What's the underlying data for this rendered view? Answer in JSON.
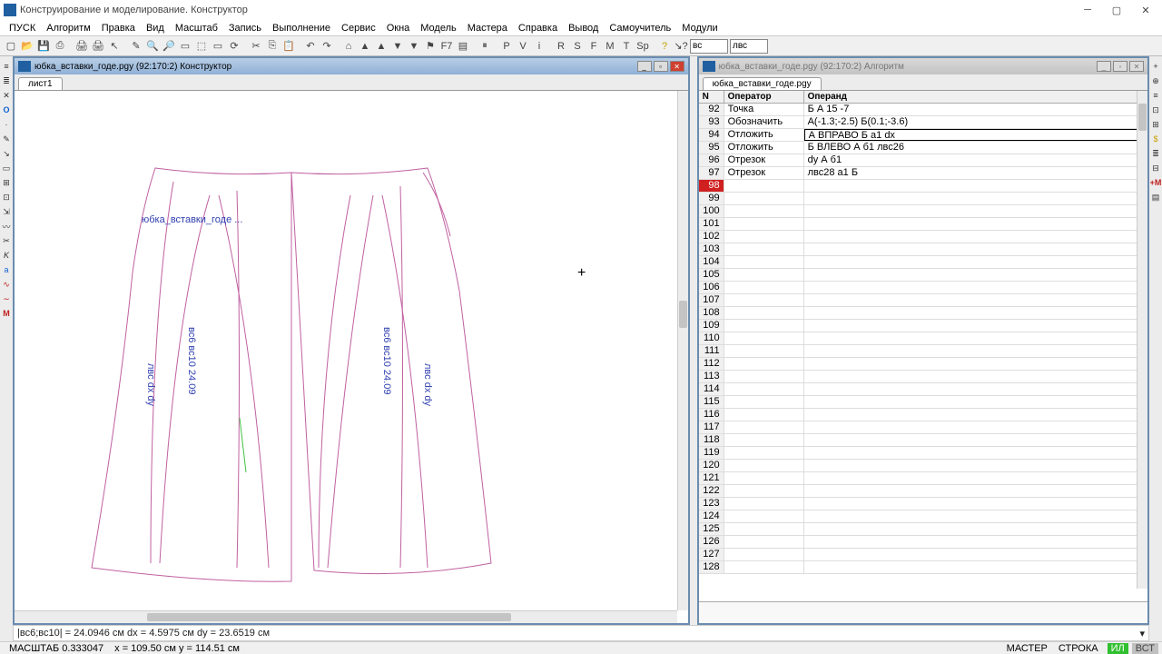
{
  "title": "Конструирование и моделирование. Конструктор",
  "menus": [
    "ПУСК",
    "Алгоритм",
    "Правка",
    "Вид",
    "Масштаб",
    "Запись",
    "Выполнение",
    "Сервис",
    "Окна",
    "Модель",
    "Мастера",
    "Справка",
    "Вывод",
    "Самоучитель",
    "Модули"
  ],
  "toolbar": {
    "text_buttons": [
      "F7",
      "P",
      "V",
      "i",
      "R",
      "S",
      "F",
      "M",
      "T",
      "Sp"
    ],
    "input1": "вс",
    "input2": "лвс"
  },
  "left_panel": {
    "title": "юбка_вставки_годе.pgy (92:170:2) Конструктор",
    "tab": "лист1"
  },
  "right_panel": {
    "title": "юбка_вставки_годе.pgy (92:170:2) Алгоритм",
    "tab": "юбка_вставки_годе.pgy",
    "columns": {
      "n": "N",
      "operator": "Оператор",
      "operand": "Операнд"
    },
    "rows": [
      {
        "n": "92",
        "op": "Точка",
        "oper": "Б А 15 -7"
      },
      {
        "n": "93",
        "op": "Обозначить",
        "oper": "А(-1.3;-2.5) Б(0.1;-3.6)"
      },
      {
        "n": "94",
        "op": "Отложить",
        "oper": "А ВПРАВО Б а1 dx",
        "active": true
      },
      {
        "n": "95",
        "op": "Отложить",
        "oper": "Б ВЛЕВО А б1 лвс26"
      },
      {
        "n": "96",
        "op": "Отрезок",
        "oper": "dy А б1"
      },
      {
        "n": "97",
        "op": "Отрезок",
        "oper": "лвс28 а1 Б"
      },
      {
        "n": "98",
        "op": "",
        "oper": "",
        "highlight": true
      },
      {
        "n": "99",
        "op": "",
        "oper": ""
      },
      {
        "n": "100",
        "op": "",
        "oper": ""
      },
      {
        "n": "101",
        "op": "",
        "oper": ""
      },
      {
        "n": "102",
        "op": "",
        "oper": ""
      },
      {
        "n": "103",
        "op": "",
        "oper": ""
      },
      {
        "n": "104",
        "op": "",
        "oper": ""
      },
      {
        "n": "105",
        "op": "",
        "oper": ""
      },
      {
        "n": "106",
        "op": "",
        "oper": ""
      },
      {
        "n": "107",
        "op": "",
        "oper": ""
      },
      {
        "n": "108",
        "op": "",
        "oper": ""
      },
      {
        "n": "109",
        "op": "",
        "oper": ""
      },
      {
        "n": "110",
        "op": "",
        "oper": ""
      },
      {
        "n": "111",
        "op": "",
        "oper": ""
      },
      {
        "n": "112",
        "op": "",
        "oper": ""
      },
      {
        "n": "113",
        "op": "",
        "oper": ""
      },
      {
        "n": "114",
        "op": "",
        "oper": ""
      },
      {
        "n": "115",
        "op": "",
        "oper": ""
      },
      {
        "n": "116",
        "op": "",
        "oper": ""
      },
      {
        "n": "117",
        "op": "",
        "oper": ""
      },
      {
        "n": "118",
        "op": "",
        "oper": ""
      },
      {
        "n": "119",
        "op": "",
        "oper": ""
      },
      {
        "n": "120",
        "op": "",
        "oper": ""
      },
      {
        "n": "121",
        "op": "",
        "oper": ""
      },
      {
        "n": "122",
        "op": "",
        "oper": ""
      },
      {
        "n": "123",
        "op": "",
        "oper": ""
      },
      {
        "n": "124",
        "op": "",
        "oper": ""
      },
      {
        "n": "125",
        "op": "",
        "oper": ""
      },
      {
        "n": "126",
        "op": "",
        "oper": ""
      },
      {
        "n": "127",
        "op": "",
        "oper": ""
      },
      {
        "n": "128",
        "op": "",
        "oper": ""
      }
    ]
  },
  "info_bar": "|вс6;вс10| = 24.0946 см   dx = 4.5975 см   dy = 23.6519 см",
  "status": {
    "scale": "МАСШТАБ 0.333047",
    "coords": "x = 109.50 см   y = 114.51 см",
    "master": "МАСТЕР",
    "stroka": "СТРОКА",
    "badge1": "ИЛ",
    "badge2": "ВСТ"
  }
}
